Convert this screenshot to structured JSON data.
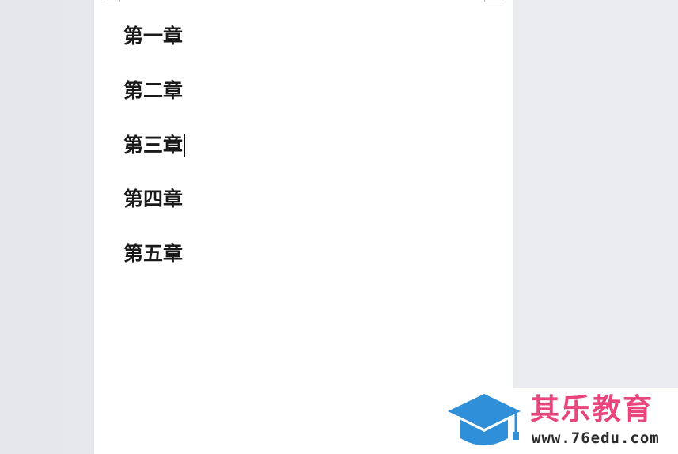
{
  "document": {
    "headings": [
      "第一章",
      "第二章",
      "第三章",
      "第四章",
      "第五章"
    ]
  },
  "watermark": {
    "title": "其乐教育",
    "url": "www.76edu.com",
    "icon": "graduation-cap-icon",
    "title_color": "#e8467c",
    "icon_color": "#2f8fd8"
  }
}
